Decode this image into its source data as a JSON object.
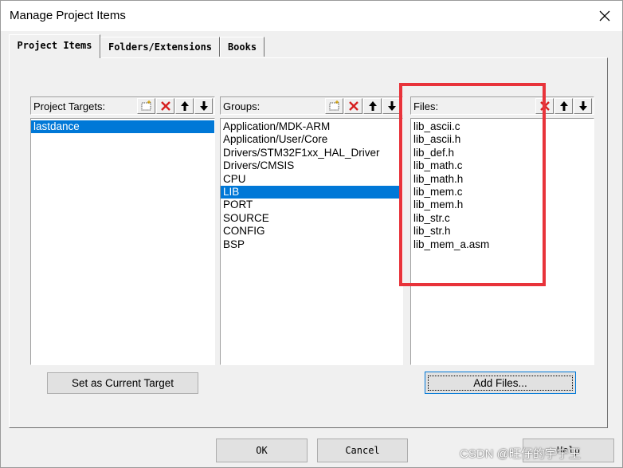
{
  "dialog": {
    "title": "Manage Project Items",
    "close_glyph": "✕"
  },
  "tabs": [
    {
      "label": "Project Items",
      "active": true
    },
    {
      "label": "Folders/Extensions",
      "active": false
    },
    {
      "label": "Books",
      "active": false
    }
  ],
  "targets": {
    "title": "Project Targets:",
    "tools": [
      "new-icon",
      "delete-icon",
      "move-up-icon",
      "move-down-icon"
    ],
    "items": [
      "lastdance"
    ],
    "selected_index": 0,
    "button_label": "Set as Current Target"
  },
  "groups": {
    "title": "Groups:",
    "tools": [
      "new-icon",
      "delete-icon",
      "move-up-icon",
      "move-down-icon"
    ],
    "items": [
      "Application/MDK-ARM",
      "Application/User/Core",
      "Drivers/STM32F1xx_HAL_Driver",
      "Drivers/CMSIS",
      "CPU",
      "LIB",
      "PORT",
      "SOURCE",
      "CONFIG",
      "BSP"
    ],
    "selected_index": 5
  },
  "files": {
    "title": "Files:",
    "tools": [
      "delete-icon",
      "move-up-icon",
      "move-down-icon"
    ],
    "items": [
      "lib_ascii.c",
      "lib_ascii.h",
      "lib_def.h",
      "lib_math.c",
      "lib_math.h",
      "lib_mem.c",
      "lib_mem.h",
      "lib_str.c",
      "lib_str.h",
      "lib_mem_a.asm"
    ],
    "button_label": "Add Files..."
  },
  "footer": {
    "ok_label": "OK",
    "cancel_label": "Cancel",
    "help_label": "Help"
  },
  "watermark": "CSDN @旺仔的宇宁王",
  "colors": {
    "selection": "#0078d7",
    "highlight_box": "#e8333a",
    "delete_icon": "#d62020"
  }
}
